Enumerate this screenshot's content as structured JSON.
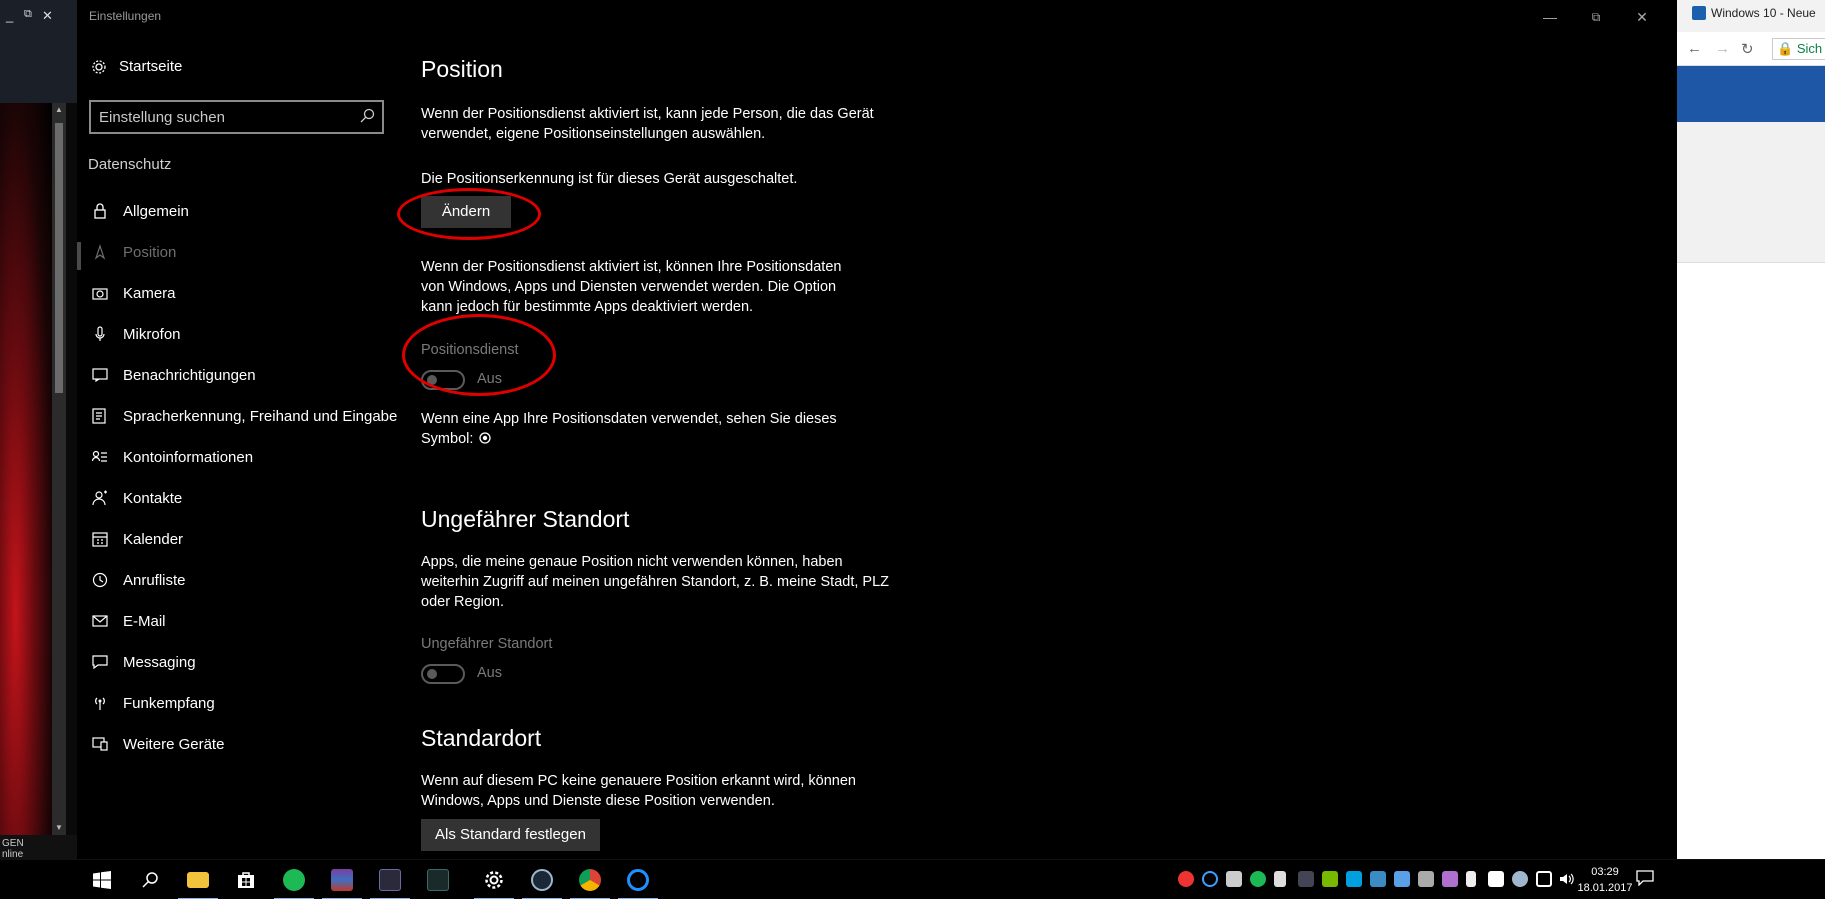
{
  "left_window": {
    "controls": [
      "_",
      "⧉",
      "✕"
    ],
    "bottom_text_1": "GEN",
    "bottom_text_2": "nline"
  },
  "settings": {
    "window_title": "Einstellungen",
    "home_label": "Startseite",
    "search_placeholder": "Einstellung suchen",
    "group_label": "Datenschutz",
    "nav": [
      {
        "label": "Allgemein",
        "icon": "lock-icon"
      },
      {
        "label": "Position",
        "icon": "location-icon",
        "selected": true
      },
      {
        "label": "Kamera",
        "icon": "camera-icon"
      },
      {
        "label": "Mikrofon",
        "icon": "microphone-icon"
      },
      {
        "label": "Benachrichtigungen",
        "icon": "notification-icon"
      },
      {
        "label": "Spracherkennung, Freihand und Eingabe",
        "icon": "pen-icon"
      },
      {
        "label": "Kontoinformationen",
        "icon": "account-info-icon"
      },
      {
        "label": "Kontakte",
        "icon": "contacts-icon"
      },
      {
        "label": "Kalender",
        "icon": "calendar-icon"
      },
      {
        "label": "Anrufliste",
        "icon": "call-history-icon"
      },
      {
        "label": "E-Mail",
        "icon": "mail-icon"
      },
      {
        "label": "Messaging",
        "icon": "messaging-icon"
      },
      {
        "label": "Funkempfang",
        "icon": "radio-icon"
      },
      {
        "label": "Weitere Geräte",
        "icon": "devices-icon"
      }
    ],
    "content": {
      "title": "Position",
      "intro": "Wenn der Positionsdienst aktiviert ist, kann jede Person, die das Gerät verwendet, eigene Positionseinstellungen auswählen.",
      "status": "Die Positionserkennung ist für dieses Gerät ausgeschaltet.",
      "change_button": "Ändern",
      "service_desc": "Wenn der Positionsdienst aktiviert ist, können Ihre Positionsdaten von Windows, Apps und Diensten verwendet werden. Die Option kann jedoch für bestimmte Apps deaktiviert werden.",
      "service_label": "Positionsdienst",
      "service_state": "Aus",
      "symbol_text": "Wenn eine App Ihre Positionsdaten verwendet, sehen Sie dieses Symbol:",
      "approx_title": "Ungefährer Standort",
      "approx_desc": "Apps, die meine genaue Position nicht verwenden können, haben weiterhin Zugriff auf meinen ungefähren Standort, z. B. meine Stadt, PLZ oder Region.",
      "approx_label": "Ungefährer Standort",
      "approx_state": "Aus",
      "default_title": "Standardort",
      "default_desc": "Wenn auf diesem PC keine genauere Position erkannt wird, können Windows, Apps und Dienste diese Position verwenden.",
      "default_button": "Als Standard festlegen"
    },
    "annotation_color": "#e00000"
  },
  "browser": {
    "tab_title": "Windows 10 - Neue",
    "secure_label": "Sich"
  },
  "taskbar": {
    "time": "03:29",
    "date": "18.01.2017",
    "apps": [
      "windows-start-icon",
      "search-icon",
      "file-explorer-icon",
      "store-icon",
      "spotify-icon",
      "winrar-icon",
      "app-icon",
      "app-icon",
      "settings-icon",
      "steam-icon",
      "chrome-icon",
      "app-refresh-icon"
    ]
  }
}
